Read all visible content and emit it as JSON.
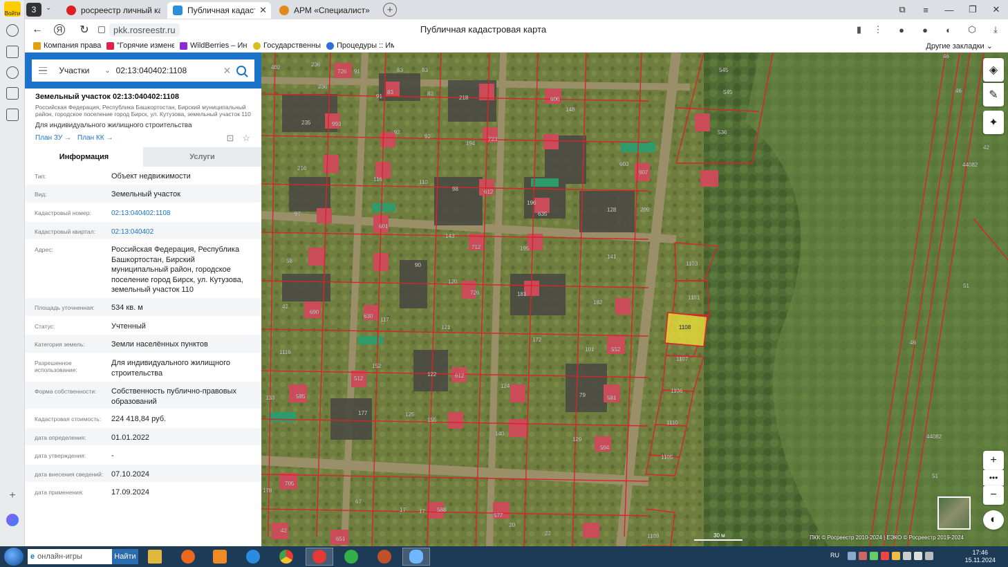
{
  "browser": {
    "tab_count": "3",
    "tabs": [
      {
        "label": "росреестр личный кабин",
        "active": false,
        "color": "#e02020"
      },
      {
        "label": "Публичная кадастрова",
        "active": true,
        "color": "#2b90d9"
      },
      {
        "label": "АРМ «Специалист»",
        "active": false,
        "color": "#e08a1e"
      }
    ],
    "url": "pkk.rosreestr.ru",
    "page_title": "Публичная кадастровая карта",
    "login_label": "Войти",
    "bookmarks": [
      {
        "label": "Компания права",
        "color": "#e0a010"
      },
      {
        "label": "\"Горячие измене",
        "color": "#e0204a"
      },
      {
        "label": "WildBerries – Инте",
        "color": "#8b2bd9"
      },
      {
        "label": "Государственный",
        "color": "#d9c020"
      },
      {
        "label": "Процедуры :: Им",
        "color": "#2b70d9"
      }
    ],
    "other_bookmarks": "Другие закладки"
  },
  "search": {
    "type_label": "Участки",
    "query": "02:13:040402:1108"
  },
  "object": {
    "title": "Земельный участок 02:13:040402:1108",
    "address_short": "Российская Федерация, Республика Башкортостан, Бирский муниципальный район, городское поселение город Бирск, ул. Кутузова, земельный участок 110",
    "purpose": "Для индивидуального жилищного строительства",
    "plan_zu": "План ЗУ →",
    "plan_kk": "План КК →",
    "tab_info": "Информация",
    "tab_services": "Услуги",
    "rows": [
      {
        "label": "Тип:",
        "value": "Объект недвижимости"
      },
      {
        "label": "Вид:",
        "value": "Земельный участок"
      },
      {
        "label": "Кадастровый номер:",
        "value": "02:13:040402:1108",
        "link": true
      },
      {
        "label": "Кадастровый квартал:",
        "value": "02:13:040402",
        "link": true
      },
      {
        "label": "Адрес:",
        "value": "Российская Федерация, Республика Башкортостан, Бирский муниципальный район, городское поселение город Бирск, ул. Кутузова, земельный участок 110"
      },
      {
        "label": "Площадь уточненная:",
        "value": "534 кв. м"
      },
      {
        "label": "Статус:",
        "value": "Учтенный"
      },
      {
        "label": "Категория земель:",
        "value": "Земли населённых пунктов"
      },
      {
        "label": "Разрешенное использование:",
        "value": "Для индивидуального жилищного строительства"
      },
      {
        "label": "Форма собственности:",
        "value": "Собственность публично-правовых образований"
      },
      {
        "label": "Кадастровая стоимость:",
        "value": "224 418,84 руб."
      },
      {
        "label": "дата определения:",
        "value": "01.01.2022"
      },
      {
        "label": "дата утверждения:",
        "value": "-"
      },
      {
        "label": "дата внесения сведений:",
        "value": "07.10.2024"
      },
      {
        "label": "дата применения:",
        "value": "17.09.2024"
      }
    ]
  },
  "map": {
    "scale_label": "30 м",
    "attribution": "ПКК © Росреестр 2010-2024 | ЕЭКО © Росреестр 2019-2024",
    "selected_parcel": "1108",
    "labels": [
      "402",
      "236",
      "726",
      "91",
      "83",
      "83",
      "236",
      "91",
      "83",
      "83",
      "218",
      "606",
      "148",
      "545",
      "545",
      "993",
      "235",
      "92",
      "92",
      "194",
      "723",
      "536",
      "116",
      "216",
      "110",
      "603",
      "907",
      "97",
      "601",
      "98",
      "612",
      "196",
      "635",
      "128",
      "209",
      "58",
      "90",
      "143",
      "712",
      "195",
      "141",
      "1103",
      "42",
      "690",
      "120",
      "726",
      "182",
      "1101",
      "630",
      "117",
      "121",
      "181",
      "172",
      "101",
      "552",
      "1108",
      "1116",
      "152",
      "512",
      "122",
      "612",
      "124",
      "79",
      "1107",
      "133",
      "585",
      "177",
      "155",
      "125",
      "140",
      "581",
      "1106",
      "1110",
      "129",
      "504",
      "1105",
      "178",
      "705",
      "67",
      "17",
      "588",
      "577",
      "20",
      "22",
      "1109",
      "651",
      "42",
      "46",
      "44082",
      "51",
      "46",
      "44082",
      "51",
      "46"
    ]
  },
  "taskbar": {
    "search_placeholder": "онлайн-игры",
    "search_button": "Найти",
    "lang": "RU",
    "time": "17:46",
    "date": "15.11.2024"
  }
}
